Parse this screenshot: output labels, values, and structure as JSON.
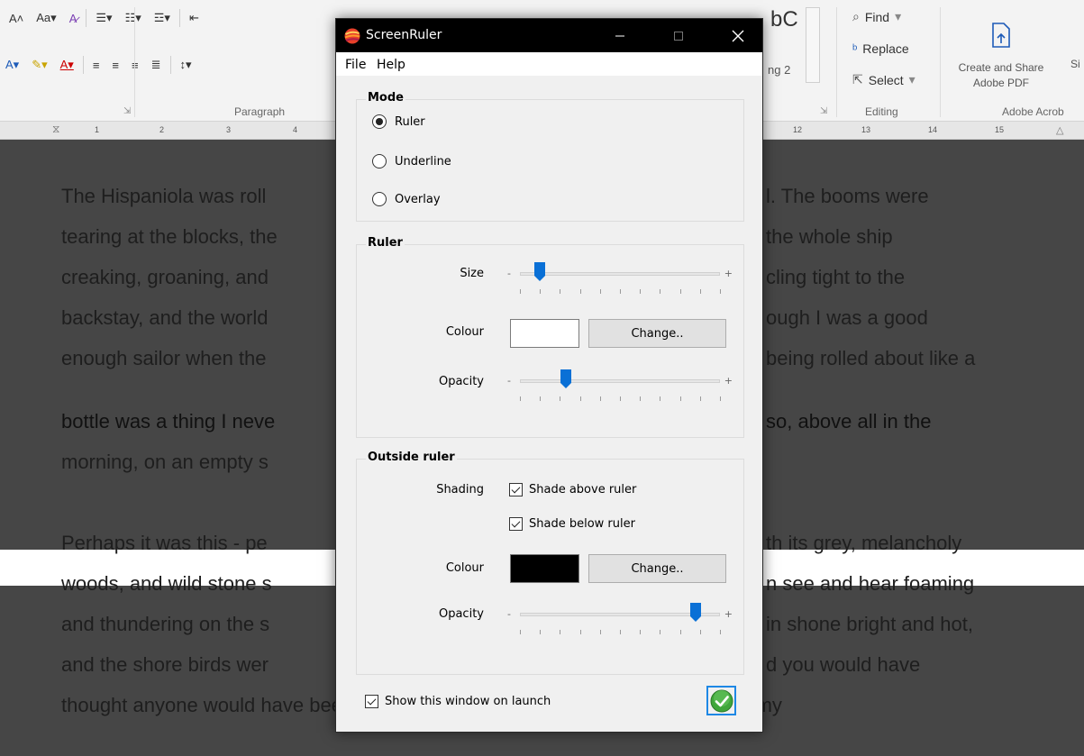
{
  "ribbon": {
    "paragraph_label": "Paragraph",
    "editing_label": "Editing",
    "adobe_label": "Adobe Acrob",
    "find_label": "Find",
    "replace_label": "Replace",
    "select_label": "Select",
    "styles_partial": "bC",
    "heading_partial": "ng 2",
    "create_share_line1": "Create and Share",
    "create_share_line2": "Adobe PDF",
    "trailing_partial": "Si",
    "font_size_label": "Aa",
    "ruler_numbers_left": [
      "1",
      "2",
      "3",
      "4"
    ],
    "ruler_numbers_right": [
      "12",
      "13",
      "14",
      "15"
    ]
  },
  "document": {
    "lines_left": [
      "The Hispaniola was roll",
      "tearing at the blocks, the",
      "creaking, groaning, and",
      "backstay, and the world",
      "enough sailor when the",
      "bottle was a thing I neve",
      "morning, on an empty s",
      "Perhaps it was this - pe",
      "woods, and wild stone s",
      "and thundering on the s",
      "and the shore birds wer",
      "thought anyone would have been glad to get to land after being so long at sea, my"
    ],
    "lines_right": [
      "l. The booms were",
      "the whole ship",
      "cling tight to the",
      "ough I was a good",
      "being rolled about like a",
      "so, above all in the",
      "",
      "th its grey, melancholy",
      "n see and hear foaming",
      "in shone bright and hot,",
      "d you would have",
      ""
    ]
  },
  "window": {
    "title": "ScreenRuler",
    "menu": {
      "file": "File",
      "help": "Help"
    },
    "mode": {
      "legend": "Mode",
      "options": [
        {
          "label": "Ruler",
          "selected": true
        },
        {
          "label": "Underline",
          "selected": false
        },
        {
          "label": "Overlay",
          "selected": false
        }
      ]
    },
    "ruler": {
      "legend": "Ruler",
      "size_label": "Size",
      "size_value": 0.1,
      "colour_label": "Colour",
      "colour_value": "#ffffff",
      "change_label": "Change..",
      "opacity_label": "Opacity",
      "opacity_value": 0.23
    },
    "outside": {
      "legend": "Outside ruler",
      "shading_label": "Shading",
      "shade_above_label": "Shade above ruler",
      "shade_above_checked": true,
      "shade_below_label": "Shade below ruler",
      "shade_below_checked": true,
      "colour_label": "Colour",
      "colour_value": "#000000",
      "change_label": "Change..",
      "opacity_label": "Opacity",
      "opacity_value": 0.88
    },
    "show_on_launch_label": "Show this window on launch",
    "show_on_launch_checked": true,
    "slider_minus": "-",
    "slider_plus": "+"
  }
}
